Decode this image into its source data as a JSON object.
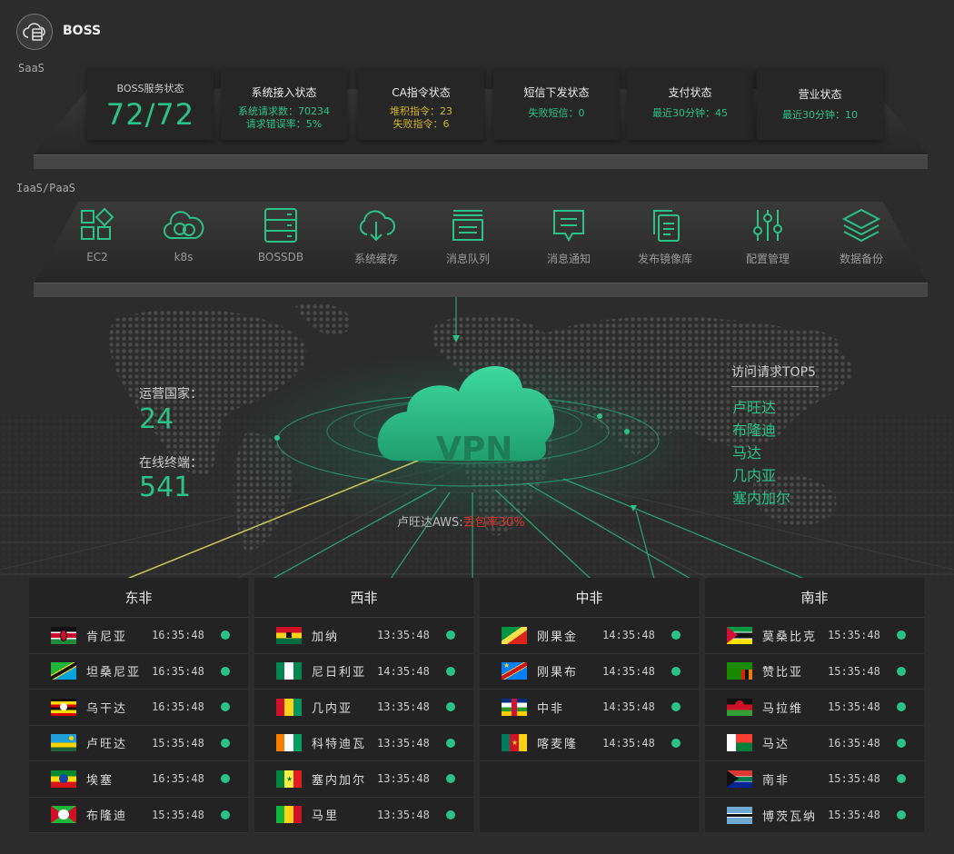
{
  "header": {
    "title": "BOSS",
    "logo_icon": "cloud-server-icon"
  },
  "saas": {
    "label": "SaaS",
    "cards": [
      {
        "title": "BOSS服务状态",
        "value": "72/72"
      },
      {
        "title": "系统接入状态",
        "lines": [
          "系统请求数：70234",
          "请求错误率：5%"
        ]
      },
      {
        "title": "CA指令状态",
        "lines": [
          "堆积指令：23",
          "失败指令：6"
        ]
      },
      {
        "title": "短信下发状态",
        "lines": [
          "失败短信：0"
        ]
      },
      {
        "title": "支付状态",
        "lines": [
          "最近30分钟：45"
        ]
      },
      {
        "title": "营业状态",
        "lines": [
          "最近30分钟：10"
        ]
      }
    ]
  },
  "paas": {
    "label": "IaaS/PaaS",
    "services": [
      {
        "name": "EC2",
        "icon": "app-grid-icon"
      },
      {
        "name": "k8s",
        "icon": "cloud-outline-icon"
      },
      {
        "name": "BOSSDB",
        "icon": "database-server-icon"
      },
      {
        "name": "系统缓存",
        "icon": "cloud-download-icon"
      },
      {
        "name": "消息队列",
        "icon": "queue-stack-icon"
      },
      {
        "name": "消息通知",
        "icon": "message-bubble-icon"
      },
      {
        "name": "发布镜像库",
        "icon": "image-copy-icon"
      },
      {
        "name": "配置管理",
        "icon": "sliders-icon"
      },
      {
        "name": "数据备份",
        "icon": "layers-icon"
      }
    ]
  },
  "stats": {
    "countries_label": "运营国家：",
    "countries_value": "24",
    "terminals_label": "在线终端：",
    "terminals_value": "541"
  },
  "vpn": {
    "label": "VPN",
    "alert_prefix": "卢旺达AWS:",
    "alert_value": "丢包率30%"
  },
  "top5": {
    "title": "访问请求TOP5",
    "items": [
      "卢旺达",
      "布隆迪",
      "马达",
      "几内亚",
      "塞内加尔"
    ]
  },
  "regions": [
    {
      "name": "东非",
      "rows": [
        {
          "country": "肯尼亚",
          "time": "16:35:48",
          "flag": "kenya"
        },
        {
          "country": "坦桑尼亚",
          "time": "16:35:48",
          "flag": "tanzania"
        },
        {
          "country": "乌干达",
          "time": "16:35:48",
          "flag": "uganda"
        },
        {
          "country": "卢旺达",
          "time": "15:35:48",
          "flag": "rwanda"
        },
        {
          "country": "埃塞",
          "time": "16:35:48",
          "flag": "ethiopia"
        },
        {
          "country": "布隆迪",
          "time": "15:35:48",
          "flag": "burundi"
        }
      ]
    },
    {
      "name": "西非",
      "rows": [
        {
          "country": "加纳",
          "time": "13:35:48",
          "flag": "ghana"
        },
        {
          "country": "尼日利亚",
          "time": "14:35:48",
          "flag": "nigeria"
        },
        {
          "country": "几内亚",
          "time": "13:35:48",
          "flag": "guinea"
        },
        {
          "country": "科特迪瓦",
          "time": "13:35:48",
          "flag": "ivory"
        },
        {
          "country": "塞内加尔",
          "time": "13:35:48",
          "flag": "senegal"
        },
        {
          "country": "马里",
          "time": "13:35:48",
          "flag": "mali"
        }
      ]
    },
    {
      "name": "中非",
      "rows": [
        {
          "country": "刚果金",
          "time": "14:35:48",
          "flag": "congo"
        },
        {
          "country": "刚果布",
          "time": "14:35:48",
          "flag": "drc"
        },
        {
          "country": "中非",
          "time": "14:35:48",
          "flag": "car"
        },
        {
          "country": "喀麦隆",
          "time": "14:35:48",
          "flag": "cameroon"
        }
      ]
    },
    {
      "name": "南非",
      "rows": [
        {
          "country": "莫桑比克",
          "time": "15:35:48",
          "flag": "mozambique"
        },
        {
          "country": "赞比亚",
          "time": "15:35:48",
          "flag": "zambia"
        },
        {
          "country": "马拉维",
          "time": "15:35:48",
          "flag": "malawi"
        },
        {
          "country": "马达",
          "time": "16:35:48",
          "flag": "madagascar"
        },
        {
          "country": "南非",
          "time": "15:35:48",
          "flag": "southafrica"
        },
        {
          "country": "博茨瓦纳",
          "time": "15:35:48",
          "flag": "botswana"
        }
      ]
    }
  ],
  "colors": {
    "accent": "#2bc28a",
    "alert": "#e0352b",
    "warning": "#d2b52a"
  }
}
